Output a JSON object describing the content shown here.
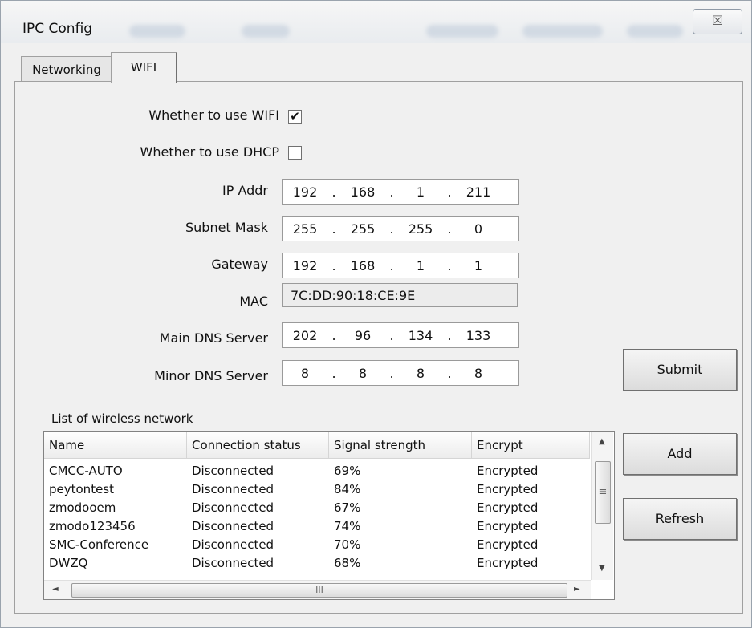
{
  "window": {
    "title": "IPC Config",
    "close_label": "☒"
  },
  "tabs": [
    {
      "label": "Networking"
    },
    {
      "label": "WIFI"
    }
  ],
  "form": {
    "use_wifi": {
      "label": "Whether to use WIFI",
      "checked_mark": "✔"
    },
    "use_dhcp": {
      "label": "Whether to use DHCP",
      "checked_mark": ""
    },
    "ip_addr": {
      "label": "IP Addr",
      "octets": [
        "192",
        "168",
        "1",
        "211"
      ]
    },
    "subnet_mask": {
      "label": "Subnet Mask",
      "octets": [
        "255",
        "255",
        "255",
        "0"
      ]
    },
    "gateway": {
      "label": "Gateway",
      "octets": [
        "192",
        "168",
        "1",
        "1"
      ]
    },
    "mac": {
      "label": "MAC",
      "value": "7C:DD:90:18:CE:9E"
    },
    "main_dns": {
      "label": "Main DNS Server",
      "octets": [
        "202",
        "96",
        "134",
        "133"
      ]
    },
    "minor_dns": {
      "label": "Minor DNS Server",
      "octets": [
        "8",
        "8",
        "8",
        "8"
      ]
    },
    "separator": "."
  },
  "buttons": {
    "submit": "Submit",
    "add": "Add",
    "refresh": "Refresh"
  },
  "wireless_list": {
    "title": "List of wireless network",
    "columns": [
      "Name",
      "Connection status",
      "Signal strength",
      "Encrypt"
    ],
    "rows": [
      [
        "CMCC-AUTO",
        "Disconnected",
        "69%",
        "Encrypted"
      ],
      [
        "peytontest",
        "Disconnected",
        "84%",
        "Encrypted"
      ],
      [
        "zmodooem",
        "Disconnected",
        "67%",
        "Encrypted"
      ],
      [
        "zmodo123456",
        "Disconnected",
        "74%",
        "Encrypted"
      ],
      [
        "SMC-Conference",
        "Disconnected",
        "70%",
        "Encrypted"
      ],
      [
        "DWZQ",
        "Disconnected",
        "68%",
        "Encrypted"
      ]
    ]
  },
  "scroll_glyphs": {
    "up": "▲",
    "down": "▼",
    "left": "◄",
    "right": "►",
    "v_grip": "≡",
    "h_grip": "III"
  }
}
